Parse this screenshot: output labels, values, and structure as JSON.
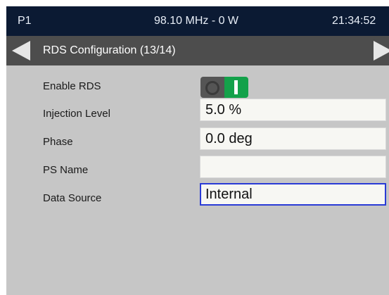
{
  "status_bar": {
    "preset": "P1",
    "frequency_power": "98.10 MHz - 0 W",
    "clock": "21:34:52"
  },
  "title_bar": {
    "title": "RDS Configuration (13/14)",
    "prev_icon": "left-arrow-icon",
    "next_icon": "right-arrow-icon"
  },
  "settings": {
    "enable_rds": {
      "label": "Enable RDS",
      "enabled": true
    },
    "injection_level": {
      "label": "Injection Level",
      "value": "5.0 %"
    },
    "phase": {
      "label": "Phase",
      "value": "0.0 deg"
    },
    "ps_name": {
      "label": "PS Name",
      "value": ""
    },
    "data_source": {
      "label": "Data Source",
      "value": "Internal",
      "selected": true
    }
  },
  "colors": {
    "status_bar_bg": "#0b1a33",
    "title_bar_bg": "#4d4d4d",
    "panel_bg": "#c6c6c6",
    "toggle_on": "#13a14a",
    "selection_border": "#2a3bd6"
  }
}
